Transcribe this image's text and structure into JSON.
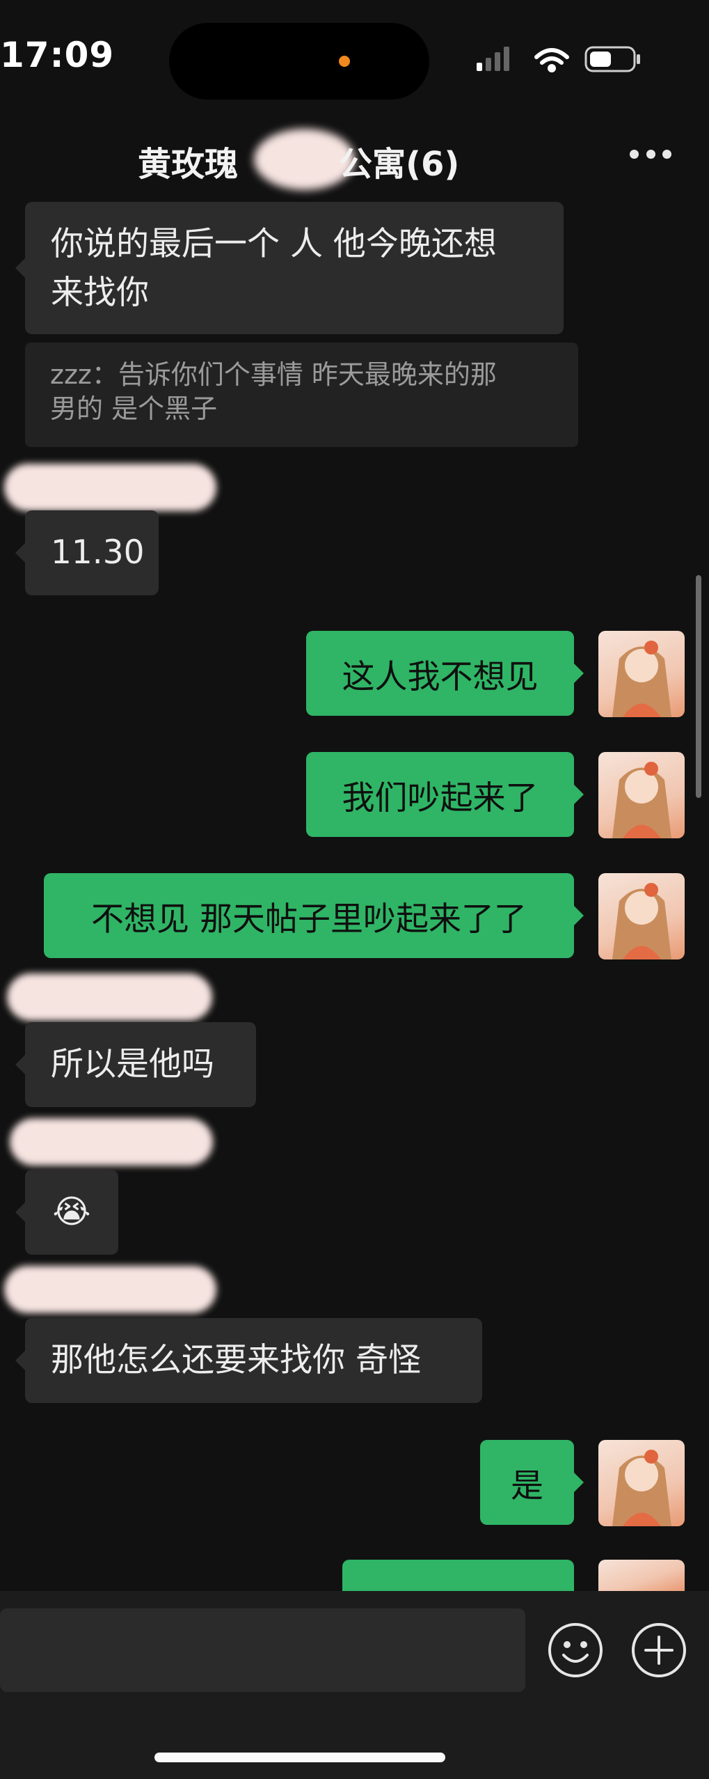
{
  "status_bar": {
    "time": "17:09",
    "icons": [
      "signal-icon",
      "wifi-icon",
      "battery-icon"
    ]
  },
  "header": {
    "title_left": "黄玫瑰",
    "title_right": "公寓(6)",
    "more_icon": "more-icon"
  },
  "messages": {
    "m1": {
      "line1": "你说的最后一个 人 他今晚还想",
      "line2": "来找你"
    },
    "quote": {
      "line1": "zzz：告诉你们个事情 昨天最晚来的那",
      "line2": "男的 是个黑子"
    },
    "m2": "11.30",
    "m3": "这人我不想见",
    "m4": "我们吵起来了",
    "m5": "不想见 那天帖子里吵起来了了",
    "m6": "所以是他吗",
    "m7": "😭",
    "m8": "那他怎么还要来找你 奇怪",
    "m9": "是"
  },
  "input_bar": {
    "emoji_icon": "emoji-icon",
    "plus_icon": "plus-icon"
  },
  "colors": {
    "background": "#111111",
    "incoming_bubble": "#2c2c2c",
    "outgoing_bubble": "#2fb565",
    "quote_bubble": "#222222"
  }
}
